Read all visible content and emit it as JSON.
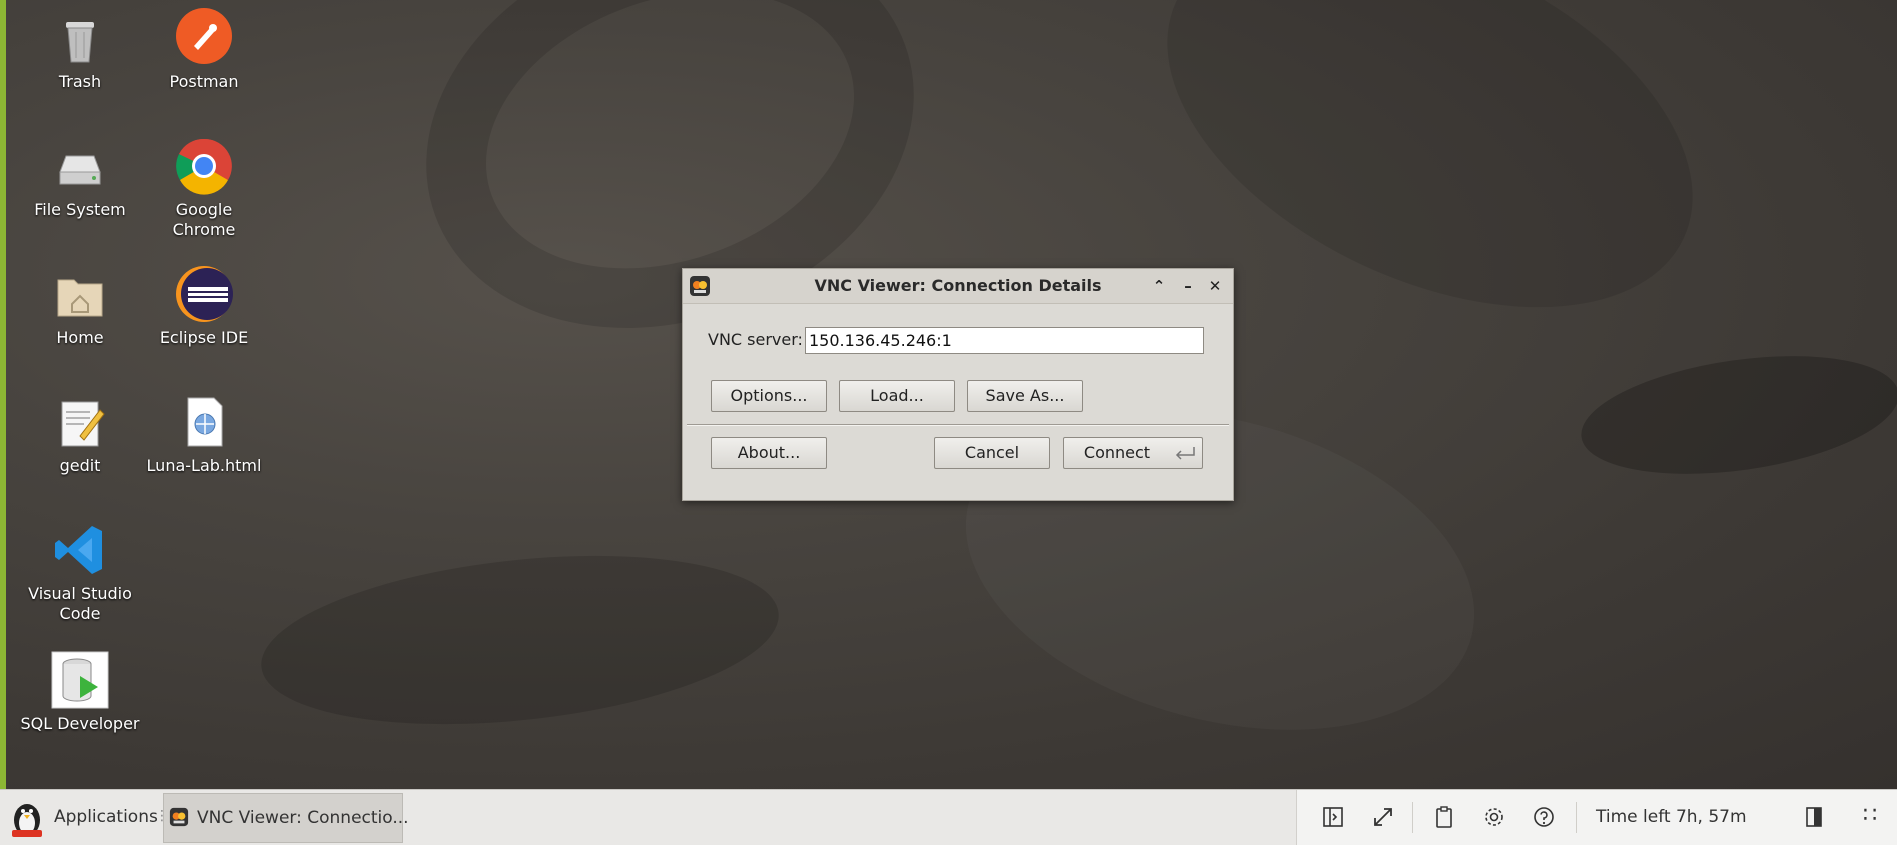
{
  "desktop": {
    "icons": [
      {
        "label": "Trash",
        "icon": "trash-icon"
      },
      {
        "label": "Postman",
        "icon": "postman-icon"
      },
      {
        "label": "File System",
        "icon": "drive-icon"
      },
      {
        "label": "Google Chrome",
        "icon": "chrome-icon"
      },
      {
        "label": "Home",
        "icon": "home-folder-icon"
      },
      {
        "label": "Eclipse IDE",
        "icon": "eclipse-icon"
      },
      {
        "label": "gedit",
        "icon": "text-editor-icon"
      },
      {
        "label": "Luna-Lab.html",
        "icon": "html-file-icon"
      },
      {
        "label": "Visual Studio Code",
        "icon": "vscode-icon"
      },
      {
        "label": "SQL Developer",
        "icon": "sql-developer-icon"
      }
    ]
  },
  "dialog": {
    "title": "VNC Viewer: Connection Details",
    "server_label": "VNC server:",
    "server_value": "150.136.45.246:1",
    "buttons": {
      "options": "Options...",
      "load": "Load...",
      "save_as": "Save As...",
      "about": "About...",
      "cancel": "Cancel",
      "connect": "Connect"
    }
  },
  "taskbar": {
    "applications_label": "Applications",
    "window_button": "VNC Viewer: Connectio...",
    "time_left": "Time left 7h, 57m"
  },
  "colors": {
    "desktop_bg": "#48443f",
    "accent_bar": "#8cb634",
    "dialog_bg": "#dcdad5",
    "taskbar_bg": "#e9e8e6"
  }
}
